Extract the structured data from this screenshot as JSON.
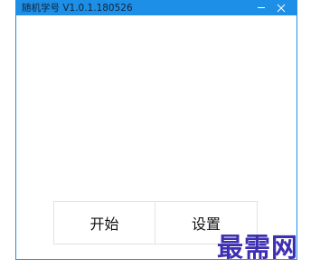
{
  "window": {
    "title": "随机学号 V1.0.1.180526",
    "minimize_icon": "minimize-icon",
    "close_icon": "close-icon",
    "accent_color": "#1e8fe6"
  },
  "actions": {
    "start_label": "开始",
    "settings_label": "设置"
  },
  "watermark": {
    "text": "最需网",
    "color": "#3d2fb0"
  }
}
